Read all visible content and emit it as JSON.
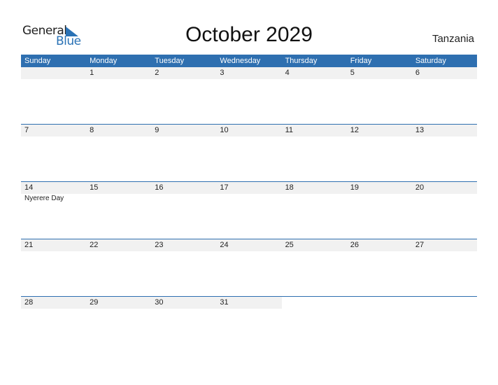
{
  "logo": {
    "general": "General",
    "blue": "Blue"
  },
  "title": "October 2029",
  "country": "Tanzania",
  "colors": {
    "accent": "#2e6fb0",
    "date_band": "#f1f1f1"
  },
  "weekdays": [
    "Sunday",
    "Monday",
    "Tuesday",
    "Wednesday",
    "Thursday",
    "Friday",
    "Saturday"
  ],
  "weeks": [
    {
      "days": [
        "",
        "1",
        "2",
        "3",
        "4",
        "5",
        "6"
      ],
      "events": [
        "",
        "",
        "",
        "",
        "",
        "",
        ""
      ]
    },
    {
      "days": [
        "7",
        "8",
        "9",
        "10",
        "11",
        "12",
        "13"
      ],
      "events": [
        "",
        "",
        "",
        "",
        "",
        "",
        ""
      ]
    },
    {
      "days": [
        "14",
        "15",
        "16",
        "17",
        "18",
        "19",
        "20"
      ],
      "events": [
        "Nyerere Day",
        "",
        "",
        "",
        "",
        "",
        ""
      ]
    },
    {
      "days": [
        "21",
        "22",
        "23",
        "24",
        "25",
        "26",
        "27"
      ],
      "events": [
        "",
        "",
        "",
        "",
        "",
        "",
        ""
      ]
    },
    {
      "days": [
        "28",
        "29",
        "30",
        "31",
        "",
        "",
        ""
      ],
      "events": [
        "",
        "",
        "",
        "",
        "",
        "",
        ""
      ]
    }
  ]
}
